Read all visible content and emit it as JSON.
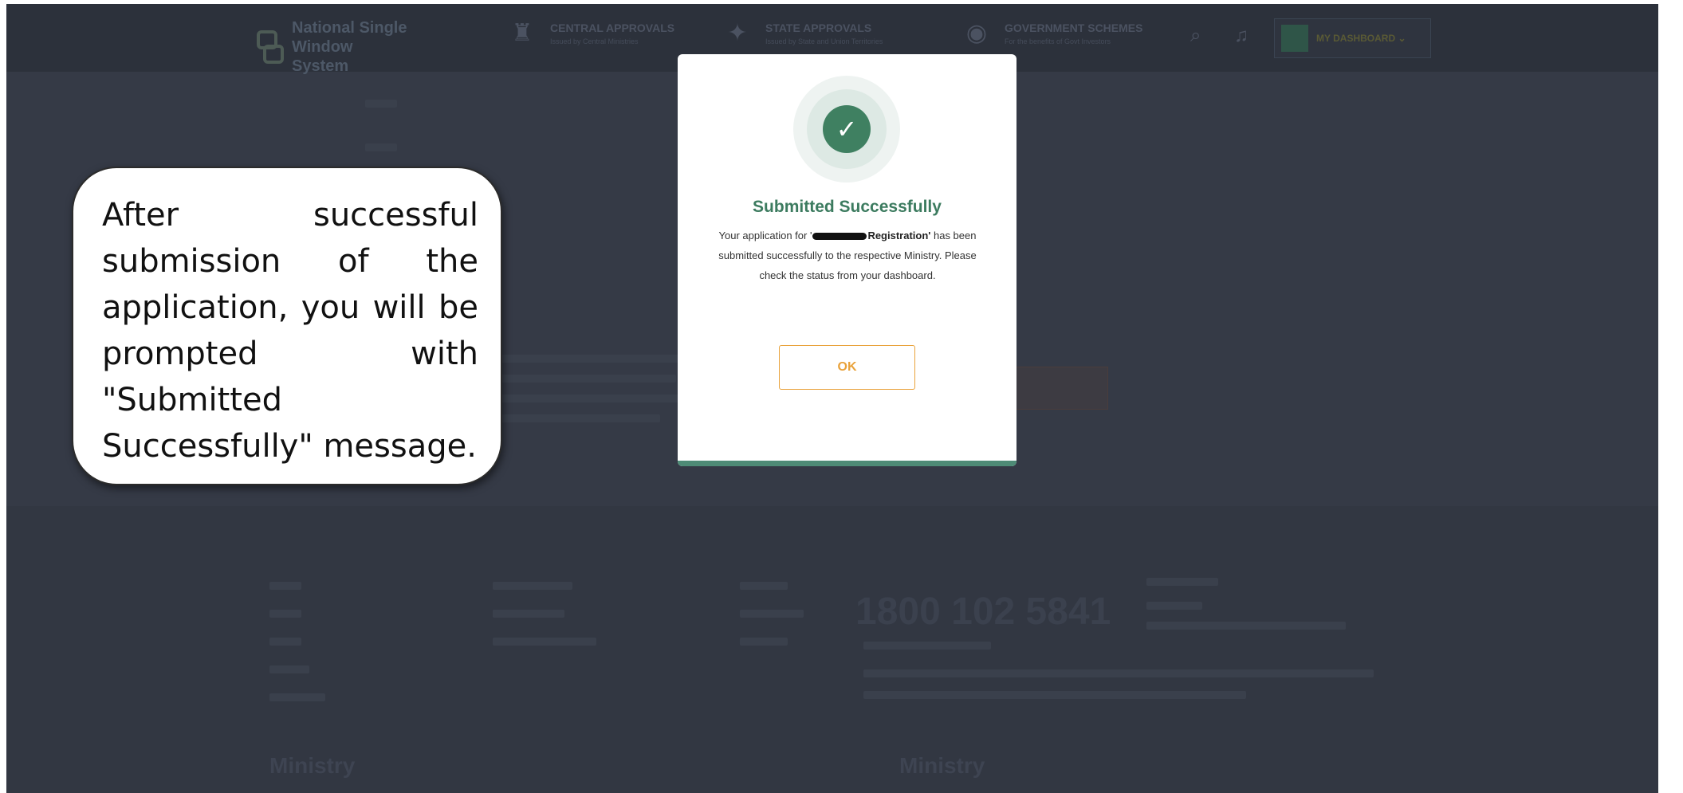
{
  "header": {
    "logo_line1": "National Single",
    "logo_line2": "Window System",
    "nav": [
      {
        "title": "CENTRAL APPROVALS",
        "sub": "Issued by Central Ministries"
      },
      {
        "title": "STATE APPROVALS",
        "sub": "Issued by State and Union Territories"
      },
      {
        "title": "GOVERNMENT SCHEMES",
        "sub": "For the benefits of Govt Investors"
      }
    ],
    "dashboard_label": "MY DASHBOARD ⌄"
  },
  "footer": {
    "phone": "1800 102 5841",
    "heading_left": "Ministry",
    "heading_right": "Ministry"
  },
  "callout": {
    "text": "After successful submission of the application, you will be prompted with \"Submitted Successfully\" message."
  },
  "modal": {
    "title": "Submitted Successfully",
    "msg_before": "Your application for '",
    "msg_bold": "Registration'",
    "msg_after": " has been submitted successfully to the respective Ministry. Please check the status from your dashboard.",
    "ok_label": "OK"
  },
  "colors": {
    "overlay": "#353a46",
    "success_green": "#3f8061",
    "ok_orange": "#e9a23b"
  }
}
